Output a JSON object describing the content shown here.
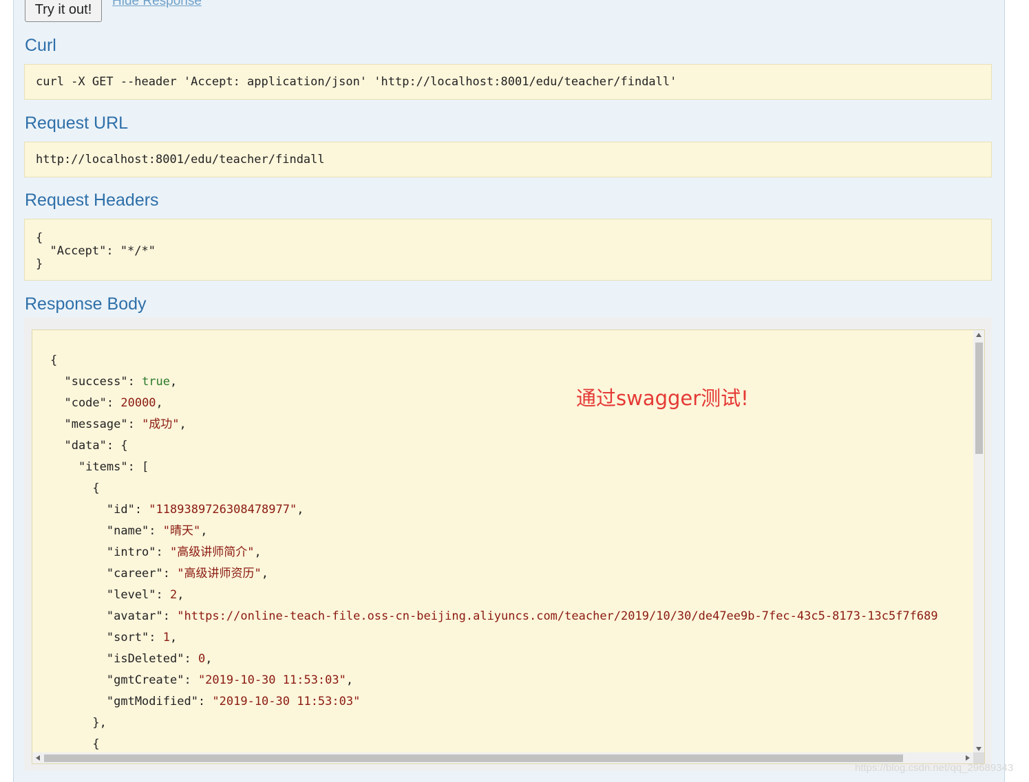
{
  "buttons": {
    "try_it_out": "Try it out!",
    "hide_response": "Hide Response"
  },
  "sections": {
    "curl": {
      "title": "Curl",
      "text": "curl -X GET --header 'Accept: application/json' 'http://localhost:8001/edu/teacher/findall'"
    },
    "request_url": {
      "title": "Request URL",
      "text": "http://localhost:8001/edu/teacher/findall"
    },
    "request_headers": {
      "title": "Request Headers",
      "lines": [
        "{",
        "  \"Accept\": \"*/*\"",
        "}"
      ]
    },
    "response_body": {
      "title": "Response Body"
    }
  },
  "response_json": {
    "success": "true",
    "code": "20000",
    "message": "\"成功\"",
    "item": {
      "id": "\"1189389726308478977\"",
      "name": "\"晴天\"",
      "intro": "\"高级讲师简介\"",
      "career": "\"高级讲师资历\"",
      "level": "2",
      "avatar": "\"https://online-teach-file.oss-cn-beijing.aliyuncs.com/teacher/2019/10/30/de47ee9b-7fec-43c5-8173-13c5f7f689",
      "sort": "1",
      "isDeleted": "0",
      "gmtCreate": "\"2019-10-30 11:53:03\"",
      "gmtModified": "\"2019-10-30 11:53:03\""
    }
  },
  "annotation": "通过swagger测试!",
  "watermark": "https://blog.csdn.net/qq_29689343",
  "colors": {
    "heading": "#2e6fa8",
    "code_bg": "#fcf6db",
    "string": "#8b1a10",
    "boolean": "#2a7a2a",
    "annotation": "#e53935"
  }
}
